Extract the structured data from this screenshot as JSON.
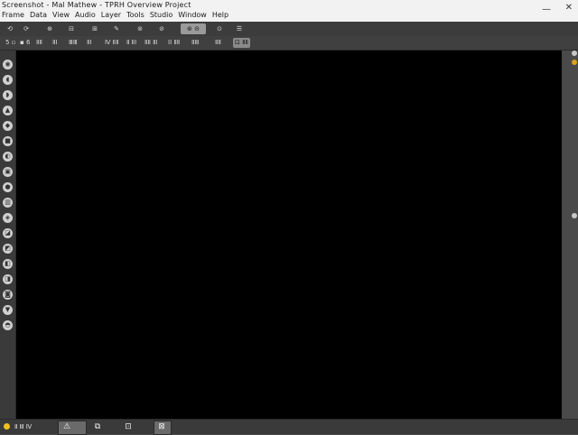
{
  "window": {
    "title": "Screenshot - Mal Mathew - TPRH Overview Project",
    "minimize_glyph": "—",
    "close_glyph": "✕"
  },
  "menu": {
    "items": [
      "Frame",
      "Data",
      "View",
      "Audio",
      "Layer",
      "Tools",
      "Studio",
      "Window",
      "Help"
    ]
  },
  "toolbar1": {
    "items": [
      {
        "label": "⟲",
        "icon": "undo-icon"
      },
      {
        "label": "⟳",
        "icon": "redo-icon"
      },
      {
        "label": "⊕",
        "icon": "zoom-in-icon"
      },
      {
        "label": "⊟",
        "icon": "frame-icon"
      },
      {
        "label": "⊞",
        "icon": "grid-icon"
      },
      {
        "label": "✎",
        "icon": "pencil-icon"
      },
      {
        "label": "⊚",
        "icon": "target-icon"
      },
      {
        "label": "⊘",
        "icon": "mask-icon"
      },
      {
        "label": "⊙",
        "icon": "record-icon"
      },
      {
        "label": "☰",
        "icon": "menu-icon"
      }
    ],
    "active_label": "⊛ ⊝"
  },
  "toolbar2": {
    "items": [
      "5 ▫",
      "▪ 6",
      "ⅡⅡ",
      "ⅡⅠ",
      "ⅢⅢ",
      "ⅡⅠ",
      "Ⅳ ⅡⅡ",
      "Ⅱ ⅡⅠ",
      "ⅡⅡ ⅡⅠ",
      "ⅠⅠ ⅡⅡ",
      "ⅡⅢ",
      "ⅡⅡ",
      "⊡ ⅡⅡ"
    ]
  },
  "left_tools": [
    "◉",
    "◖",
    "◗",
    "▲",
    "◆",
    "■",
    "◐",
    "▣",
    "●",
    "▥",
    "◈",
    "◪",
    "◩",
    "◧",
    "◨",
    "◙",
    "▼",
    "◓"
  ],
  "status": {
    "left_text": "Ⅱ Ⅲ Ⅳ",
    "icons": [
      {
        "glyph": "⚠",
        "name": "warning-icon"
      },
      {
        "glyph": "⧉",
        "name": "layers-icon"
      },
      {
        "glyph": "⊡",
        "name": "monitor-icon"
      },
      {
        "glyph": "⊠",
        "name": "crop-icon"
      }
    ]
  }
}
